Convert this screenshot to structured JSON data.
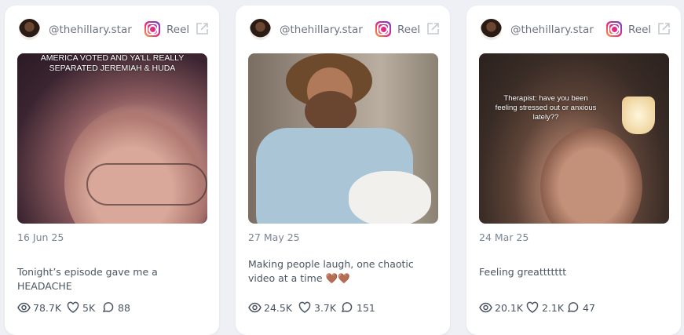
{
  "cards": [
    {
      "handle": "@thehillary.star",
      "platform_label": "Reel",
      "media_caption": "AMERICA VOTED AND YA'LL REALLY SEPARATED JEREMIAH & HUDA",
      "date": "16 Jun 25",
      "description": "Tonight’s episode gave me a HEADACHE",
      "views": "78.7K",
      "likes": "5K",
      "comments": "88"
    },
    {
      "handle": "@thehillary.star",
      "platform_label": "Reel",
      "media_caption": "",
      "date": "27 May 25",
      "description": "Making people laugh, one chaotic video at a time 🤎🤎",
      "views": "24.5K",
      "likes": "3.7K",
      "comments": "151"
    },
    {
      "handle": "@thehillary.star",
      "platform_label": "Reel",
      "media_caption": "Therapist: have you been feeling stressed out or anxious lately??",
      "date": "24 Mar 25",
      "description": "Feeling greattttttt",
      "views": "20.1K",
      "likes": "2.1K",
      "comments": "47"
    }
  ],
  "icons": {
    "platform": "instagram-icon",
    "open": "external-link-icon",
    "views": "eye-icon",
    "likes": "heart-icon",
    "comments": "comment-icon"
  },
  "colors": {
    "background": "#eef0f5",
    "card": "#ffffff",
    "muted_text": "#6b7280",
    "body_text": "#4b5563"
  }
}
